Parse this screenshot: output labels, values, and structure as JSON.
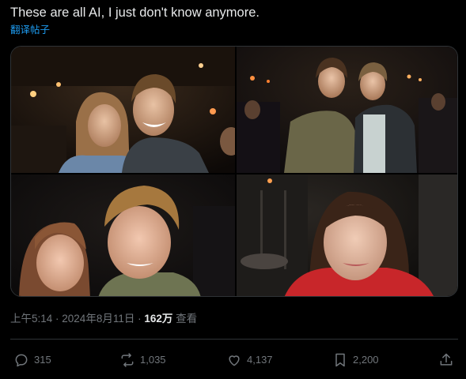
{
  "post": {
    "text": "These are all AI, I just don't know anymore.",
    "translate_label": "翻译帖子"
  },
  "media": {
    "photos": [
      {
        "description_icon": "photo-couple-restaurant"
      },
      {
        "description_icon": "photo-two-men-bar"
      },
      {
        "description_icon": "photo-young-man-woman-closeup"
      },
      {
        "description_icon": "photo-woman-red-jacket"
      }
    ]
  },
  "meta": {
    "time": "上午5:14",
    "separator": " · ",
    "date": "2024年8月11日",
    "views_count": "162万",
    "views_label": "查看"
  },
  "actions": {
    "reply_count": "315",
    "repost_count": "1,035",
    "like_count": "4,137",
    "bookmark_count": "2,200"
  },
  "colors": {
    "background": "#000000",
    "text": "#e7e9ea",
    "muted": "#71767b",
    "link": "#1d9bf0",
    "divider": "#2f3336"
  }
}
